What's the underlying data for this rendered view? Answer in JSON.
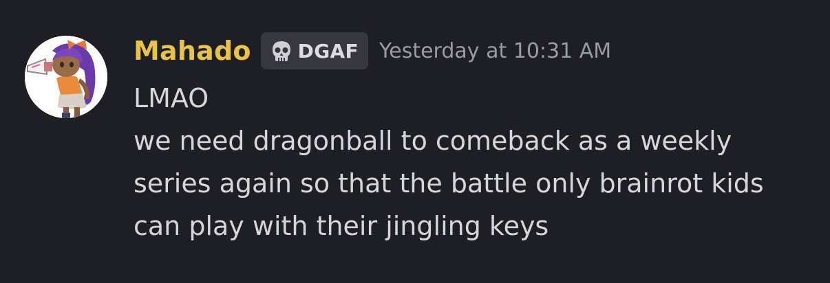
{
  "message": {
    "author": {
      "username": "Mahado",
      "username_color": "#e9c348",
      "avatar_icon": "anime-girl-avatar"
    },
    "role_tag": {
      "icon": "skull-icon",
      "label": "DGAF"
    },
    "timestamp": "Yesterday at 10:31 AM",
    "lines": [
      "LMAO",
      "we need dragonball to comeback as a weekly",
      "series again so that the battle only brainrot kids",
      "can play with their jingling keys"
    ]
  }
}
